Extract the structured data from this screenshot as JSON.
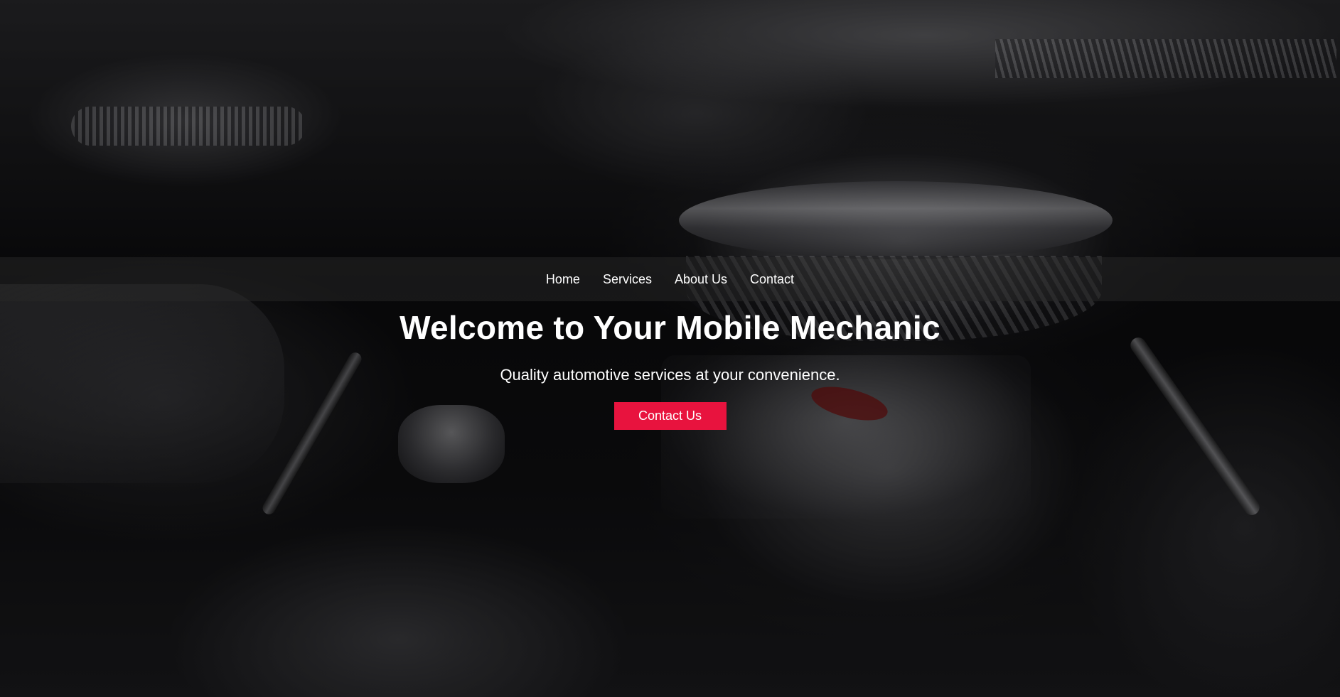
{
  "nav": {
    "items": [
      {
        "label": "Home"
      },
      {
        "label": "Services"
      },
      {
        "label": "About Us"
      },
      {
        "label": "Contact"
      }
    ]
  },
  "hero": {
    "title": "Welcome to Your Mobile Mechanic",
    "subtitle": "Quality automotive services at your convenience.",
    "cta_label": "Contact Us",
    "cta_color": "#e8133e",
    "background_image": "chrome-engine-bay-icon"
  }
}
